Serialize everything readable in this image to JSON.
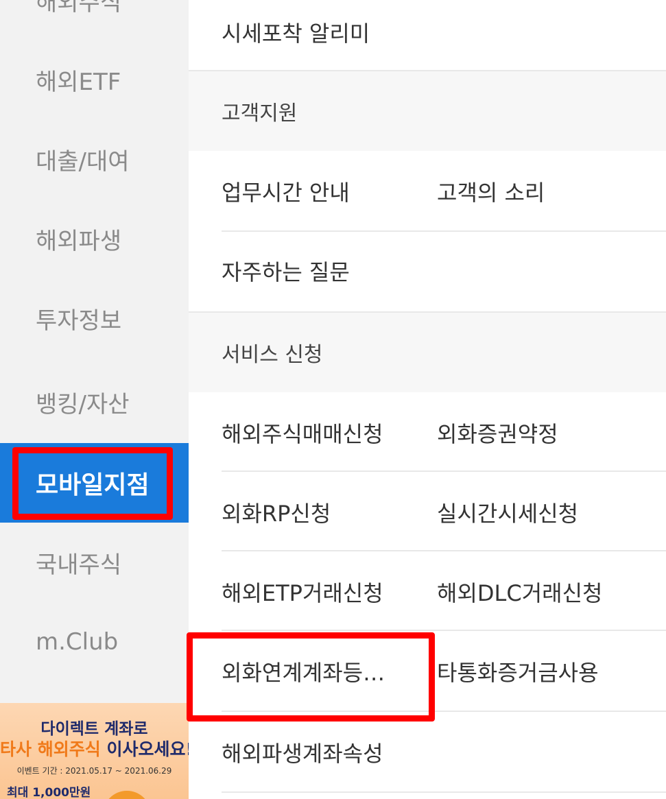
{
  "sidebar": {
    "items": [
      {
        "label": "해외주식"
      },
      {
        "label": "해외ETF"
      },
      {
        "label": "대출/대여"
      },
      {
        "label": "해외파생"
      },
      {
        "label": "투자정보"
      },
      {
        "label": "뱅킹/자산"
      },
      {
        "label": "모바일지점"
      },
      {
        "label": "국내주식"
      },
      {
        "label": "m.Club"
      }
    ],
    "active_index": 6
  },
  "banner": {
    "line1": "다이렉트 계좌로",
    "line2_orange": "타사 해외주식",
    "line2_navy": "이사오세요!",
    "period": "이벤트 기간 : 2021.05.17 ~ 2021.06.29",
    "prize": "최대 1,000만원"
  },
  "menu": {
    "top_item": "시세포착 알리미",
    "support": {
      "header": "고객지원",
      "items": [
        "업무시간 안내",
        "고객의 소리",
        "자주하는 질문"
      ]
    },
    "service": {
      "header": "서비스 신청",
      "items": [
        "해외주식매매신청",
        "외화증권약정",
        "외화RP신청",
        "실시간시세신청",
        "해외ETP거래신청",
        "해외DLC거래신청",
        "외화연계계좌등…",
        "타통화증거금사용",
        "해외파생계좌속성"
      ]
    }
  },
  "colors": {
    "active_blue": "#1a7bdb",
    "highlight_red": "#ff0000"
  }
}
